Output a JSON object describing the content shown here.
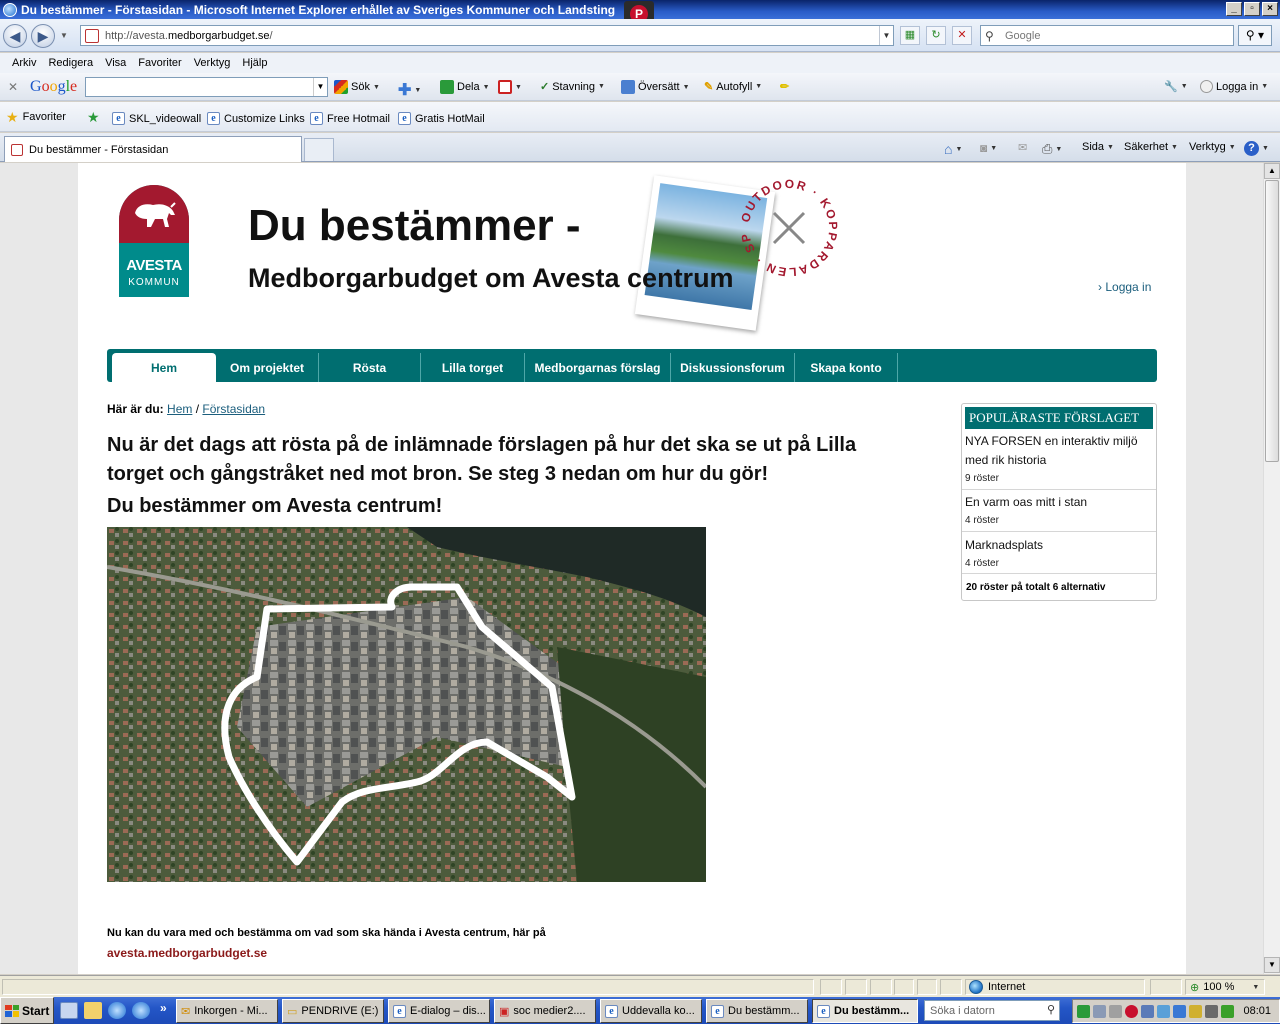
{
  "window": {
    "title": "Du bestämmer - Förstasidan - Microsoft Internet Explorer erhållet av Sveriges Kommuner och Landsting",
    "pdf_badge": "P",
    "buttons": [
      "_",
      "▫",
      "×"
    ]
  },
  "address_bar": {
    "url_prefix": "http://avesta.",
    "url_domain": "medborgarbudget.se",
    "url_suffix": "/",
    "search_placeholder": "Google"
  },
  "menu": [
    "Arkiv",
    "Redigera",
    "Visa",
    "Favoriter",
    "Verktyg",
    "Hjälp"
  ],
  "google_toolbar": {
    "logo": [
      "G",
      "o",
      "o",
      "g",
      "l",
      "e"
    ],
    "search": "Sök",
    "share": "Dela",
    "spell": "Stavning",
    "translate": "Översätt",
    "autofill": "Autofyll",
    "login": "Logga in"
  },
  "favorites": {
    "label": "Favoriter",
    "items": [
      "SKL_videowall",
      "Customize Links",
      "Free Hotmail",
      "Gratis HotMail"
    ]
  },
  "tab": {
    "title": "Du bestämmer - Förstasidan"
  },
  "commands": [
    "Sida",
    "Säkerhet",
    "Verktyg"
  ],
  "site": {
    "logo_line1": "AVESTA",
    "logo_line2": "KOMMUN",
    "title": "Du bestämmer -",
    "subtitle": "Medborgarbudget om Avesta centrum",
    "stamp_text": "OUTDOOR · KOPPARDALEN · SPORT ·",
    "login": "Logga in",
    "nav": [
      "Hem",
      "Om projektet",
      "Rösta",
      "Lilla torget",
      "Medborgarnas förslag",
      "Diskussionsforum",
      "Skapa konto"
    ],
    "breadcrumb": {
      "lead": "Här är du:",
      "home": "Hem",
      "separator": "/",
      "current": "Förstasidan"
    },
    "intro": "Nu är det dags att rösta på de inlämnade förslagen på hur det ska se ut på Lilla torget och gångstråket ned mot bron. Se steg 3 nedan om hur du gör!",
    "heading": "Du bestämmer om Avesta centrum!",
    "bottom_text": "Nu kan du vara med och bestämma om vad som ska hända i Avesta centrum, här på",
    "bottom_link": "avesta.medborgarbudget.se"
  },
  "poll": {
    "header": "POPULÄRASTE FÖRSLAGET",
    "items": [
      {
        "title": "NYA FORSEN en interaktiv miljö med rik historia",
        "votes": "9 röster"
      },
      {
        "title": "En varm oas mitt i stan",
        "votes": "4 röster"
      },
      {
        "title": "Marknadsplats",
        "votes": "4 röster"
      }
    ],
    "total": "20 röster på totalt 6 alternativ"
  },
  "statusbar": {
    "zone": "Internet",
    "zoom": "100 %"
  },
  "taskbar": {
    "start": "Start",
    "tasks": [
      "Inkorgen - Mi...",
      "PENDRIVE (E:)",
      "E-dialog – dis...",
      "soc medier2....",
      "Uddevalla ko...",
      "Du bestämm...",
      "Du bestämm..."
    ],
    "search_placeholder": "Söka i datorn",
    "clock": "08:01"
  },
  "colors": {
    "teal": "#006e70",
    "avesta_red": "#a3192f",
    "link": "#1b5e7d"
  }
}
